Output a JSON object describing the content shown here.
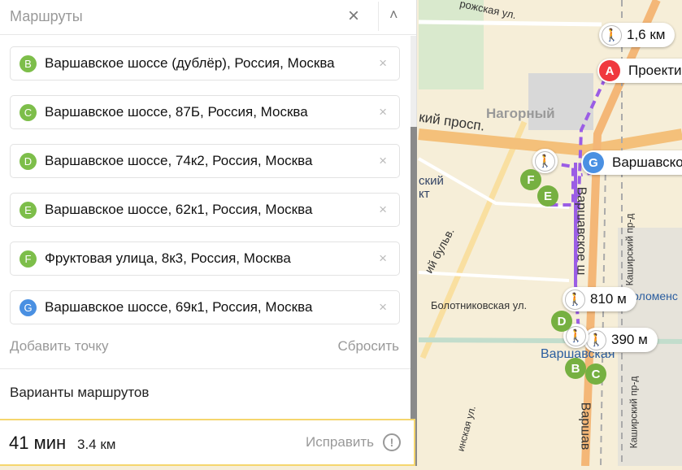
{
  "panel": {
    "title": "Маршруты",
    "close_icon": "×",
    "collapse_icon": "˄",
    "points": [
      {
        "letter": "B",
        "text": "Варшавское шоссе (дублёр), Россия, Москва",
        "color": "#7dbe4a"
      },
      {
        "letter": "C",
        "text": "Варшавское шоссе, 87Б, Россия, Москва",
        "color": "#7dbe4a"
      },
      {
        "letter": "D",
        "text": "Варшавское шоссе, 74к2, Россия, Москва",
        "color": "#7dbe4a"
      },
      {
        "letter": "E",
        "text": "Варшавское шоссе, 62к1, Россия, Москва",
        "color": "#7dbe4a"
      },
      {
        "letter": "F",
        "text": "Фруктовая улица, 8к3, Россия, Москва",
        "color": "#7dbe4a"
      },
      {
        "letter": "G",
        "text": "Варшавское шоссе, 69к1, Россия, Москва",
        "color": "#4a90e2"
      }
    ],
    "remove_icon": "×",
    "add_point": "Добавить точку",
    "reset": "Сбросить",
    "variants": "Варианты маршрутов",
    "route": {
      "time": "41 мин",
      "distance": "3.4 км",
      "fix": "Исправить",
      "warn_icon": "!"
    }
  },
  "map": {
    "pills": {
      "p1": "1,6 км",
      "p2": "810 м",
      "p3": "390 м"
    },
    "pins": {
      "a": "A",
      "a_label": "Проекти",
      "g": "G",
      "g_label": "Варшавско",
      "b": "B",
      "c": "C",
      "d": "D",
      "e": "E",
      "f": "F"
    },
    "labels": {
      "district": "Нагорный",
      "prosp": "кий просп.",
      "street1": "рожская ул.",
      "bolot": "Болотниковская ул.",
      "kolom": "Коломенс",
      "varsh_station": "Варшавская",
      "varsh_sh": "Варшавское ш",
      "varsh2": "Варшав",
      "bulv": "ий бульв.",
      "kash": "Каширский пр-д",
      "kash2": "Каширский пр-д",
      "skiy": "ский",
      "kt": "кт",
      "inskaya": "инская ул."
    },
    "walk_icon": "🚶"
  },
  "colors": {
    "route": "#9b5de5",
    "accent": "#f5d66e",
    "pin_a": "#f0383e"
  }
}
